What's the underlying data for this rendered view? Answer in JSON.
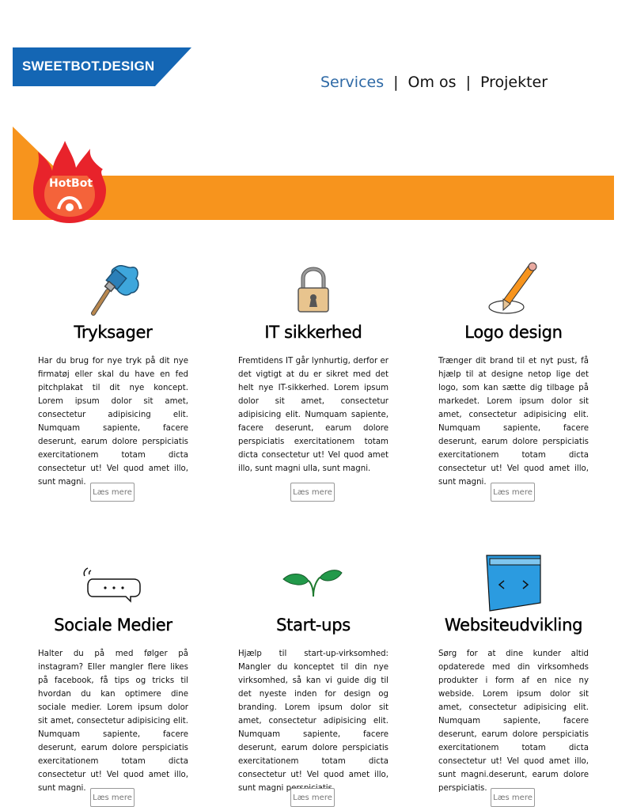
{
  "logo": {
    "text": "SWEETBOT.DESIGN",
    "color": "#1466b4"
  },
  "nav": {
    "items": [
      "Services",
      "Om os",
      "Projekter"
    ],
    "separator": "|"
  },
  "banner": {
    "label": "HotBot",
    "bar_color": "#f7941d",
    "flame_color": "#e8232b"
  },
  "cards": [
    {
      "title": "Tryksager",
      "icon": "paint-brush-icon",
      "text": "Har du brug for nye tryk på dit nye firmatøj eller skal du have en fed pitchplakat til dit nye koncept. Lorem ipsum dolor sit amet, consectetur adipisicing elit. Numquam sapiente, facere deserunt, earum dolore perspiciatis exercitationem totam dicta consectetur ut! Vel quod amet illo, sunt magni.",
      "button": "Læs mere"
    },
    {
      "title": "IT sikkerhed",
      "icon": "padlock-icon",
      "text": "Fremtidens IT går lynhurtig, derfor er det vigtigt at du er sikret med det helt nye IT-sikkerhed. Lorem ipsum dolor sit amet, consectetur adipisicing elit. Numquam sapiente, facere deserunt, earum dolore perspiciatis exercitationem totam dicta consectetur ut! Vel quod amet illo, sunt magni ulla, sunt magni.",
      "button": "Læs mere"
    },
    {
      "title": "Logo design",
      "icon": "pencil-icon",
      "text": "Trænger dit brand til et nyt pust, få hjælp til at designe netop lige det logo, som kan sætte dig tilbage på markedet. Lorem ipsum dolor sit amet, consectetur adipisicing elit. Numquam sapiente, facere deserunt, earum dolore perspiciatis exercitationem totam dicta consectetur ut! Vel quod amet illo, sunt magni.",
      "button": "Læs mere"
    },
    {
      "title": "Sociale Medier",
      "icon": "chat-bubble-icon",
      "text": "Halter du på med følger på instagram? Eller mangler flere likes på facebook, få tips og tricks til hvordan du kan optimere dine sociale medier. Lorem ipsum dolor sit amet, consectetur adipisicing elit. Numquam sapiente, facere deserunt, earum dolore perspiciatis exercitationem totam dicta consectetur ut! Vel quod amet illo, sunt magni.",
      "button": "Læs mere"
    },
    {
      "title": "Start-ups",
      "icon": "sprout-icon",
      "text": "Hjælp til start-up-virksomhed: Mangler du konceptet til din nye virksomhed, så kan vi guide dig til det nyeste inden for design og branding. Lorem ipsum dolor sit amet, consectetur adipisicing elit. Numquam sapiente, facere deserunt, earum dolore perspiciatis exercitationem totam dicta consectetur ut! Vel quod amet illo, sunt magni perspiciatis.",
      "button": "Læs mere"
    },
    {
      "title": "Websiteudvikling",
      "icon": "browser-window-icon",
      "text": "Sørg for at dine kunder altid opdaterede med din virksomheds produkter i form af en nice ny webside. Lorem ipsum dolor sit amet, consectetur adipisicing elit. Numquam sapiente, facere deserunt, earum dolore perspiciatis exercitationem totam dicta consectetur ut! Vel quod amet illo, sunt magni.deserunt, earum dolore perspiciatis.",
      "button": "Læs mere"
    }
  ]
}
